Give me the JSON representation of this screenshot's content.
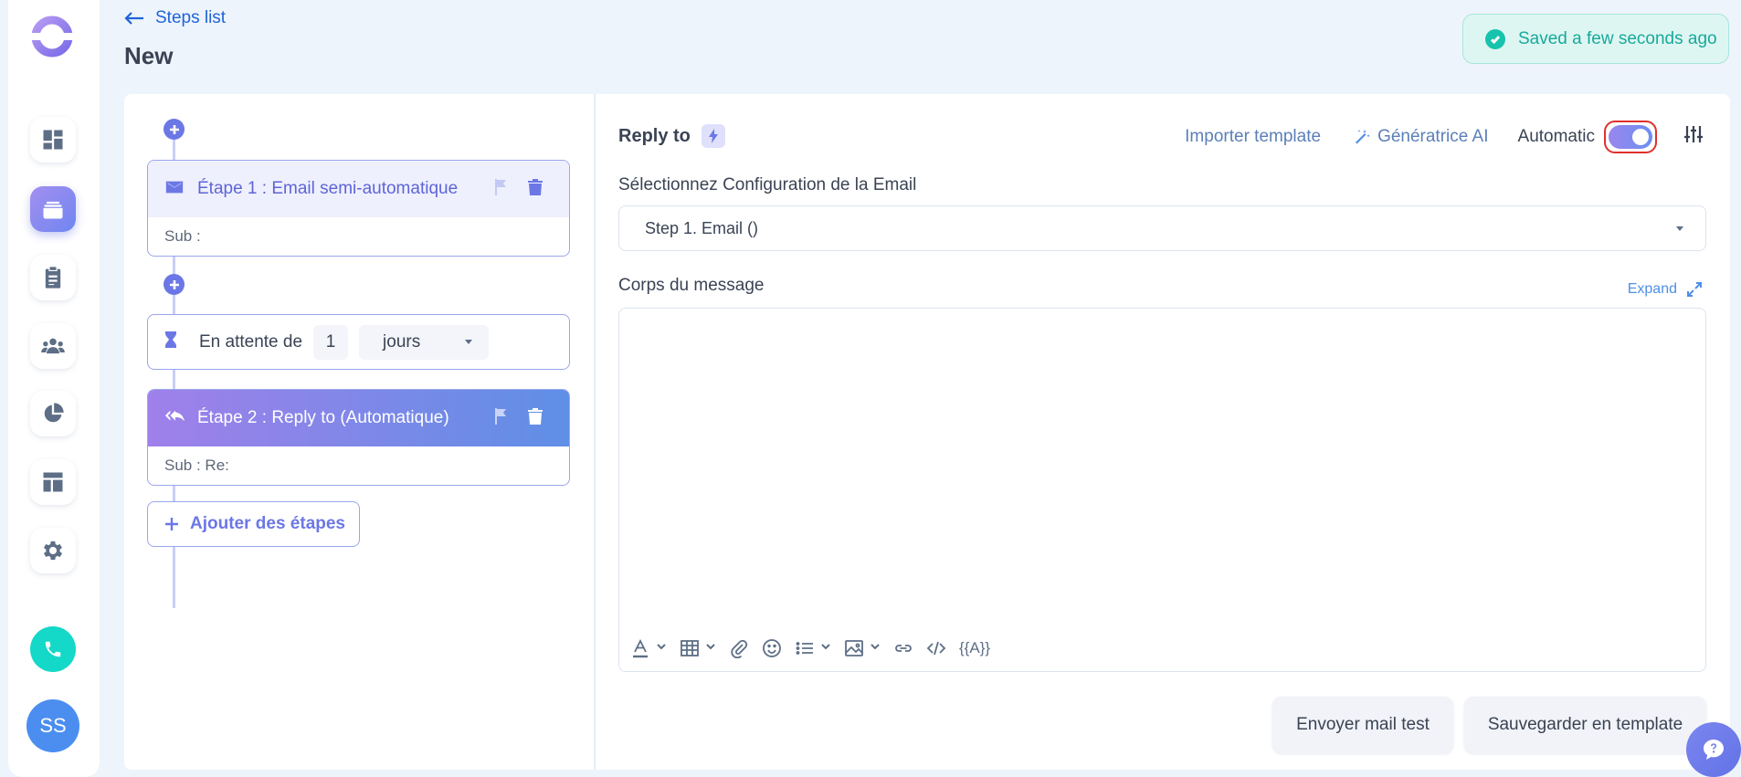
{
  "header": {
    "back_label": "Steps list",
    "page_title": "New",
    "saved_status": "Saved a few seconds ago"
  },
  "user": {
    "initials": "SS"
  },
  "steps_panel": {
    "steps": [
      {
        "title": "Étape 1 : Email semi-automatique",
        "sub": "Sub :"
      },
      {
        "title": "Étape 2 : Reply to (Automatique)",
        "sub": "Sub : Re:"
      }
    ],
    "wait": {
      "label": "En attente de",
      "value": "1",
      "unit": "jours"
    },
    "add_steps_label": "Ajouter des étapes"
  },
  "editor": {
    "title": "Reply to",
    "import_template_label": "Importer template",
    "ai_label": "Génératrice AI",
    "automatic_label": "Automatic",
    "automatic_on": true,
    "config_label": "Sélectionnez Configuration de la Email",
    "config_value": "Step 1. Email ()",
    "body_label": "Corps du message",
    "expand_label": "Expand",
    "variable_tool_label": "{{A}}",
    "send_test_label": "Envoyer mail test",
    "save_template_label": "Sauvegarder en template"
  },
  "colors": {
    "accent": "#6c77e6",
    "link": "#1f63d8",
    "success": "#18a99a",
    "toggle_focus": "#e0302c"
  },
  "icons": {
    "rail": [
      "dashboard-icon",
      "inbox-stack-icon",
      "clipboard-icon",
      "people-icon",
      "pie-chart-icon",
      "layout-icon",
      "gear-icon",
      "phone-icon"
    ],
    "toolbar": [
      "text-color-icon",
      "table-icon",
      "paperclip-icon",
      "emoji-icon",
      "list-icon",
      "image-icon",
      "link-icon",
      "code-icon"
    ]
  }
}
